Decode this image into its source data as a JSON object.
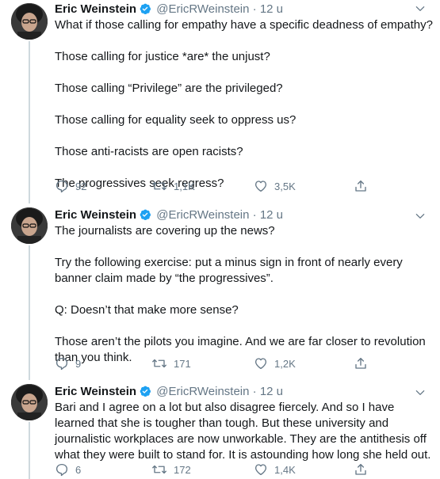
{
  "author": {
    "name": "Eric Weinstein",
    "handle": "@EricRWeinstein",
    "separator": "·"
  },
  "tweets": [
    {
      "time": "12 u",
      "paragraphs": [
        "What if those calling for empathy have a specific deadness of empathy?",
        "Those calling for justice *are* the unjust?",
        "Those calling “Privilege” are the privileged?",
        "Those calling for equality seek to oppress us?",
        "Those anti-racists are open racists?",
        "The progressives seek regress?"
      ],
      "replies": "92",
      "retweets": "1,1K",
      "likes": "3,5K"
    },
    {
      "time": "12 u",
      "paragraphs": [
        "The journalists are covering up the news?",
        "Try the following exercise: put a minus sign in front of nearly every banner claim made by “the progressives”.",
        "Q: Doesn’t that make more sense?",
        "Those aren’t the pilots you imagine. And we are far closer to revolution than you think."
      ],
      "replies": "9",
      "retweets": "171",
      "likes": "1,2K"
    },
    {
      "time": "12 u",
      "paragraphs": [
        "Bari and I agree on a lot but also disagree fiercely. And so I have learned that she is tougher than tough. But these university and journalistic workplaces are now unworkable. They are the antithesis off what they were built to stand for. It is astounding how long she held out."
      ],
      "replies": "6",
      "retweets": "172",
      "likes": "1,4K"
    }
  ],
  "icons": {
    "verified": "verified-badge-icon",
    "more": "chevron-down-icon",
    "reply": "reply-icon",
    "retweet": "retweet-icon",
    "like": "heart-icon",
    "share": "share-icon"
  },
  "colors": {
    "text": "#14171a",
    "muted": "#657786",
    "verified": "#1da1f2",
    "thread_line": "#cfd9de"
  }
}
